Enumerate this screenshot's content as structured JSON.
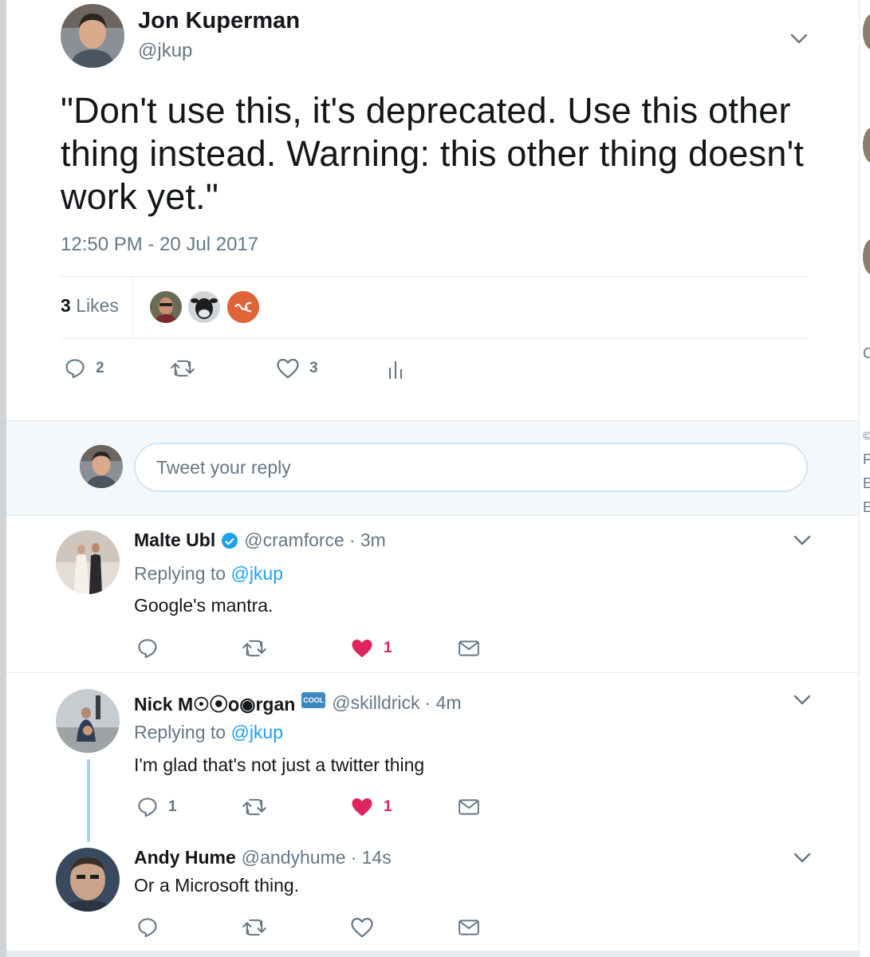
{
  "main_tweet": {
    "author_name": "Jon Kuperman",
    "author_handle": "@jkup",
    "text": "\"Don't use this, it's deprecated. Use this other thing instead. Warning: this other thing doesn't work yet.\"",
    "timestamp": "12:50 PM - 20 Jul 2017",
    "likes_count": "3",
    "likes_label": "Likes",
    "actions": {
      "reply_count": "2",
      "retweet_count": "",
      "like_count": "3"
    }
  },
  "reply_box": {
    "placeholder": "Tweet your reply"
  },
  "replies": [
    {
      "name": "Malte Ubl",
      "verified": true,
      "handle": "@cramforce",
      "time": "· 3m",
      "replying_prefix": "Replying to",
      "replying_to": "@jkup",
      "text": "Google's mantra.",
      "reply_count": "",
      "like_count": "1",
      "liked": true
    },
    {
      "name": "Nick M☉⦿໐◉rgan",
      "badge": "COOL",
      "handle": "@skilldrick",
      "time": "· 4m",
      "replying_prefix": "Replying to",
      "replying_to": "@jkup",
      "text": "I'm glad that's not just a twitter thing",
      "reply_count": "1",
      "like_count": "1",
      "liked": true
    },
    {
      "name": "Andy Hume",
      "handle": "@andyhume",
      "time": "· 14s",
      "text": "Or a Microsoft thing.",
      "reply_count": "",
      "like_count": "",
      "liked": false
    }
  ],
  "colors": {
    "accent": "#1da1f2",
    "like": "#e0245e",
    "secondary_text": "#657786",
    "thread_line": "#a8d4f5"
  },
  "sidebar_fragments": [
    "C",
    "©",
    "F",
    "E",
    "E"
  ]
}
